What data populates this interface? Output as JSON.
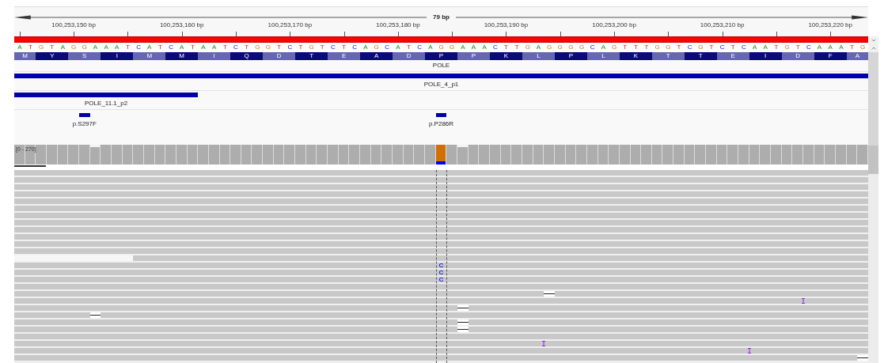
{
  "ruler": {
    "span": "79 bp",
    "ticks": [
      {
        "label": "100,253,150 bp"
      },
      {
        "label": "100,253,160 bp"
      },
      {
        "label": "100,253,170 bp"
      },
      {
        "label": "100,253,180 bp"
      },
      {
        "label": "100,253,190 bp"
      },
      {
        "label": "100,253,200 bp"
      },
      {
        "label": "100,253,210 bp"
      },
      {
        "label": "100,253,220 bp"
      }
    ]
  },
  "sequence": {
    "bases": [
      "A",
      "T",
      "G",
      "T",
      "A",
      "G",
      "G",
      "A",
      "A",
      "A",
      "T",
      "C",
      "A",
      "T",
      "C",
      "A",
      "T",
      "A",
      "A",
      "T",
      "C",
      "T",
      "G",
      "G",
      "T",
      "C",
      "T",
      "G",
      "T",
      "C",
      "T",
      "C",
      "A",
      "G",
      "C",
      "A",
      "T",
      "C",
      "A",
      "G",
      "G",
      "A",
      "A",
      "A",
      "C",
      "T",
      "T",
      "G",
      "A",
      "G",
      "G",
      "G",
      "G",
      "C",
      "A",
      "G",
      "T",
      "T",
      "T",
      "G",
      "G",
      "T",
      "C",
      "G",
      "T",
      "C",
      "T",
      "C",
      "A",
      "A",
      "T",
      "G",
      "T",
      "C",
      "A",
      "A",
      "A",
      "T",
      "G"
    ],
    "amino_acids": [
      "M",
      "Y",
      "S",
      "I",
      "M",
      "M",
      "I",
      "Q",
      "D",
      "T",
      "E",
      "A",
      "D",
      "P",
      "P",
      "K",
      "L",
      "P",
      "L",
      "K",
      "T",
      "T",
      "E",
      "I",
      "D",
      "F",
      "A"
    ]
  },
  "annotation_track": {
    "title": "POLE",
    "features": [
      {
        "name": "POLE_4_p1"
      },
      {
        "name": "POLE_11.1_p2"
      }
    ],
    "mutations": [
      {
        "label": "p.S297F"
      },
      {
        "label": "p.P286R"
      }
    ]
  },
  "coverage": {
    "range_label": "[0 - 270]"
  },
  "reads": [
    {
      "kind": "full"
    },
    {
      "kind": "full"
    },
    {
      "kind": "full"
    },
    {
      "kind": "full"
    },
    {
      "kind": "full"
    },
    {
      "kind": "full"
    },
    {
      "kind": "full"
    },
    {
      "kind": "full"
    },
    {
      "kind": "full"
    },
    {
      "kind": "full"
    },
    {
      "kind": "full"
    },
    {
      "kind": "full"
    },
    {
      "kind": "clipped"
    },
    {
      "kind": "full",
      "events": [
        {
          "kind": "mismatch",
          "text": "C"
        }
      ]
    },
    {
      "kind": "full",
      "events": [
        {
          "kind": "mismatch",
          "text": "C"
        }
      ]
    },
    {
      "kind": "full",
      "events": [
        {
          "kind": "mismatch",
          "text": "C"
        }
      ]
    },
    {
      "kind": "full"
    },
    {
      "kind": "full",
      "events": [
        {
          "kind": "deletion"
        }
      ]
    },
    {
      "kind": "full",
      "events": [
        {
          "kind": "insertion"
        }
      ]
    },
    {
      "kind": "full",
      "events": [
        {
          "kind": "deletion"
        }
      ]
    },
    {
      "kind": "full",
      "events": [
        {
          "kind": "deletion"
        }
      ]
    },
    {
      "kind": "full",
      "events": [
        {
          "kind": "deletion"
        }
      ]
    },
    {
      "kind": "full",
      "events": [
        {
          "kind": "deletion"
        }
      ]
    },
    {
      "kind": "full"
    },
    {
      "kind": "full",
      "events": [
        {
          "kind": "insertion"
        }
      ]
    },
    {
      "kind": "full",
      "events": [
        {
          "kind": "insertion"
        }
      ]
    },
    {
      "kind": "full",
      "events": [
        {
          "kind": "deletion"
        }
      ]
    }
  ]
}
